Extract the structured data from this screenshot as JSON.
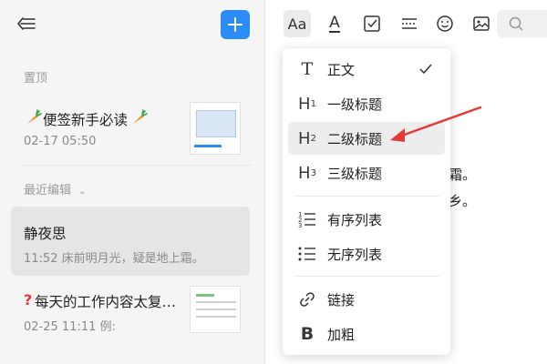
{
  "sidebar": {
    "sections": {
      "pinned": "置顶",
      "recent": "最近编辑"
    },
    "notes": [
      {
        "title": "便签新手必读",
        "time": "02-17 05:50",
        "snippet": ""
      },
      {
        "title": "静夜思",
        "time": "11:52",
        "snippet": "床前明月光，疑是地上霜。"
      },
      {
        "title": "每天的工作内容太复…",
        "time": "02-25 11:11",
        "snippet": "例:"
      }
    ]
  },
  "toolbar": {
    "items": [
      "text-style",
      "font-color",
      "checkbox",
      "divider",
      "emoji",
      "image"
    ],
    "font_label": "Aa",
    "color_label": "A",
    "search_placeholder": "Q"
  },
  "menu": {
    "items": [
      {
        "icon": "T",
        "label": "正文",
        "checked": true
      },
      {
        "icon": "H1",
        "label": "一级标题"
      },
      {
        "icon": "H2",
        "label": "二级标题",
        "hover": true
      },
      {
        "icon": "H3",
        "label": "三级标题"
      },
      {
        "icon": "ordered-list-icon",
        "label": "有序列表"
      },
      {
        "icon": "bullet-list-icon",
        "label": "无序列表"
      },
      {
        "icon": "link-icon",
        "label": "链接"
      },
      {
        "icon": "B",
        "label": "加粗"
      }
    ]
  },
  "doc": {
    "fragment1": "霜。",
    "fragment2": "乡。"
  },
  "colors": {
    "accent": "#2b8cf7",
    "arrow": "#e53935"
  }
}
